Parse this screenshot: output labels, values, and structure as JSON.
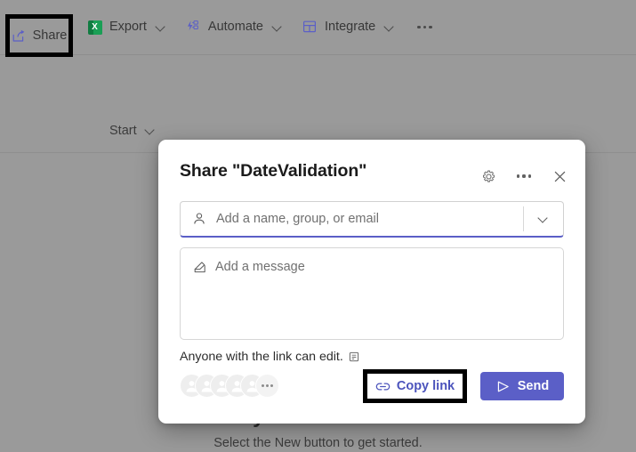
{
  "commandbar": {
    "items": [
      {
        "label": "Share",
        "icon": "share-icon",
        "has_chevron": false,
        "highlighted": true
      },
      {
        "label": "Export",
        "icon": "excel-icon",
        "has_chevron": true,
        "highlighted": false
      },
      {
        "label": "Automate",
        "icon": "automate-icon",
        "has_chevron": true,
        "highlighted": false
      },
      {
        "label": "Integrate",
        "icon": "integrate-icon",
        "has_chevron": true,
        "highlighted": false
      }
    ],
    "overflow_label": "More commands"
  },
  "page": {
    "filter_label": "Start",
    "empty_title": "your first list",
    "empty_subtitle": "Select the New button to get started."
  },
  "dialog": {
    "title": "Share \"DateValidation\"",
    "settings_label": "Link settings",
    "more_label": "More options",
    "close_label": "Close",
    "people_picker": {
      "placeholder": "Add a name, group, or email",
      "value": "",
      "expand_label": "Show suggestions"
    },
    "message": {
      "placeholder": "Add a message",
      "value": ""
    },
    "permission_text": "Anyone with the link can edit.",
    "avatars": {
      "count": 5,
      "overflow_label": "More people"
    },
    "copy_link_label": "Copy link",
    "send_label": "Send"
  },
  "colors": {
    "accent": "#5b5fc7",
    "link": "#4b53bc",
    "excel_green": "#107c41",
    "backdrop": "#9a9a9a",
    "highlight_box": "#000000"
  }
}
